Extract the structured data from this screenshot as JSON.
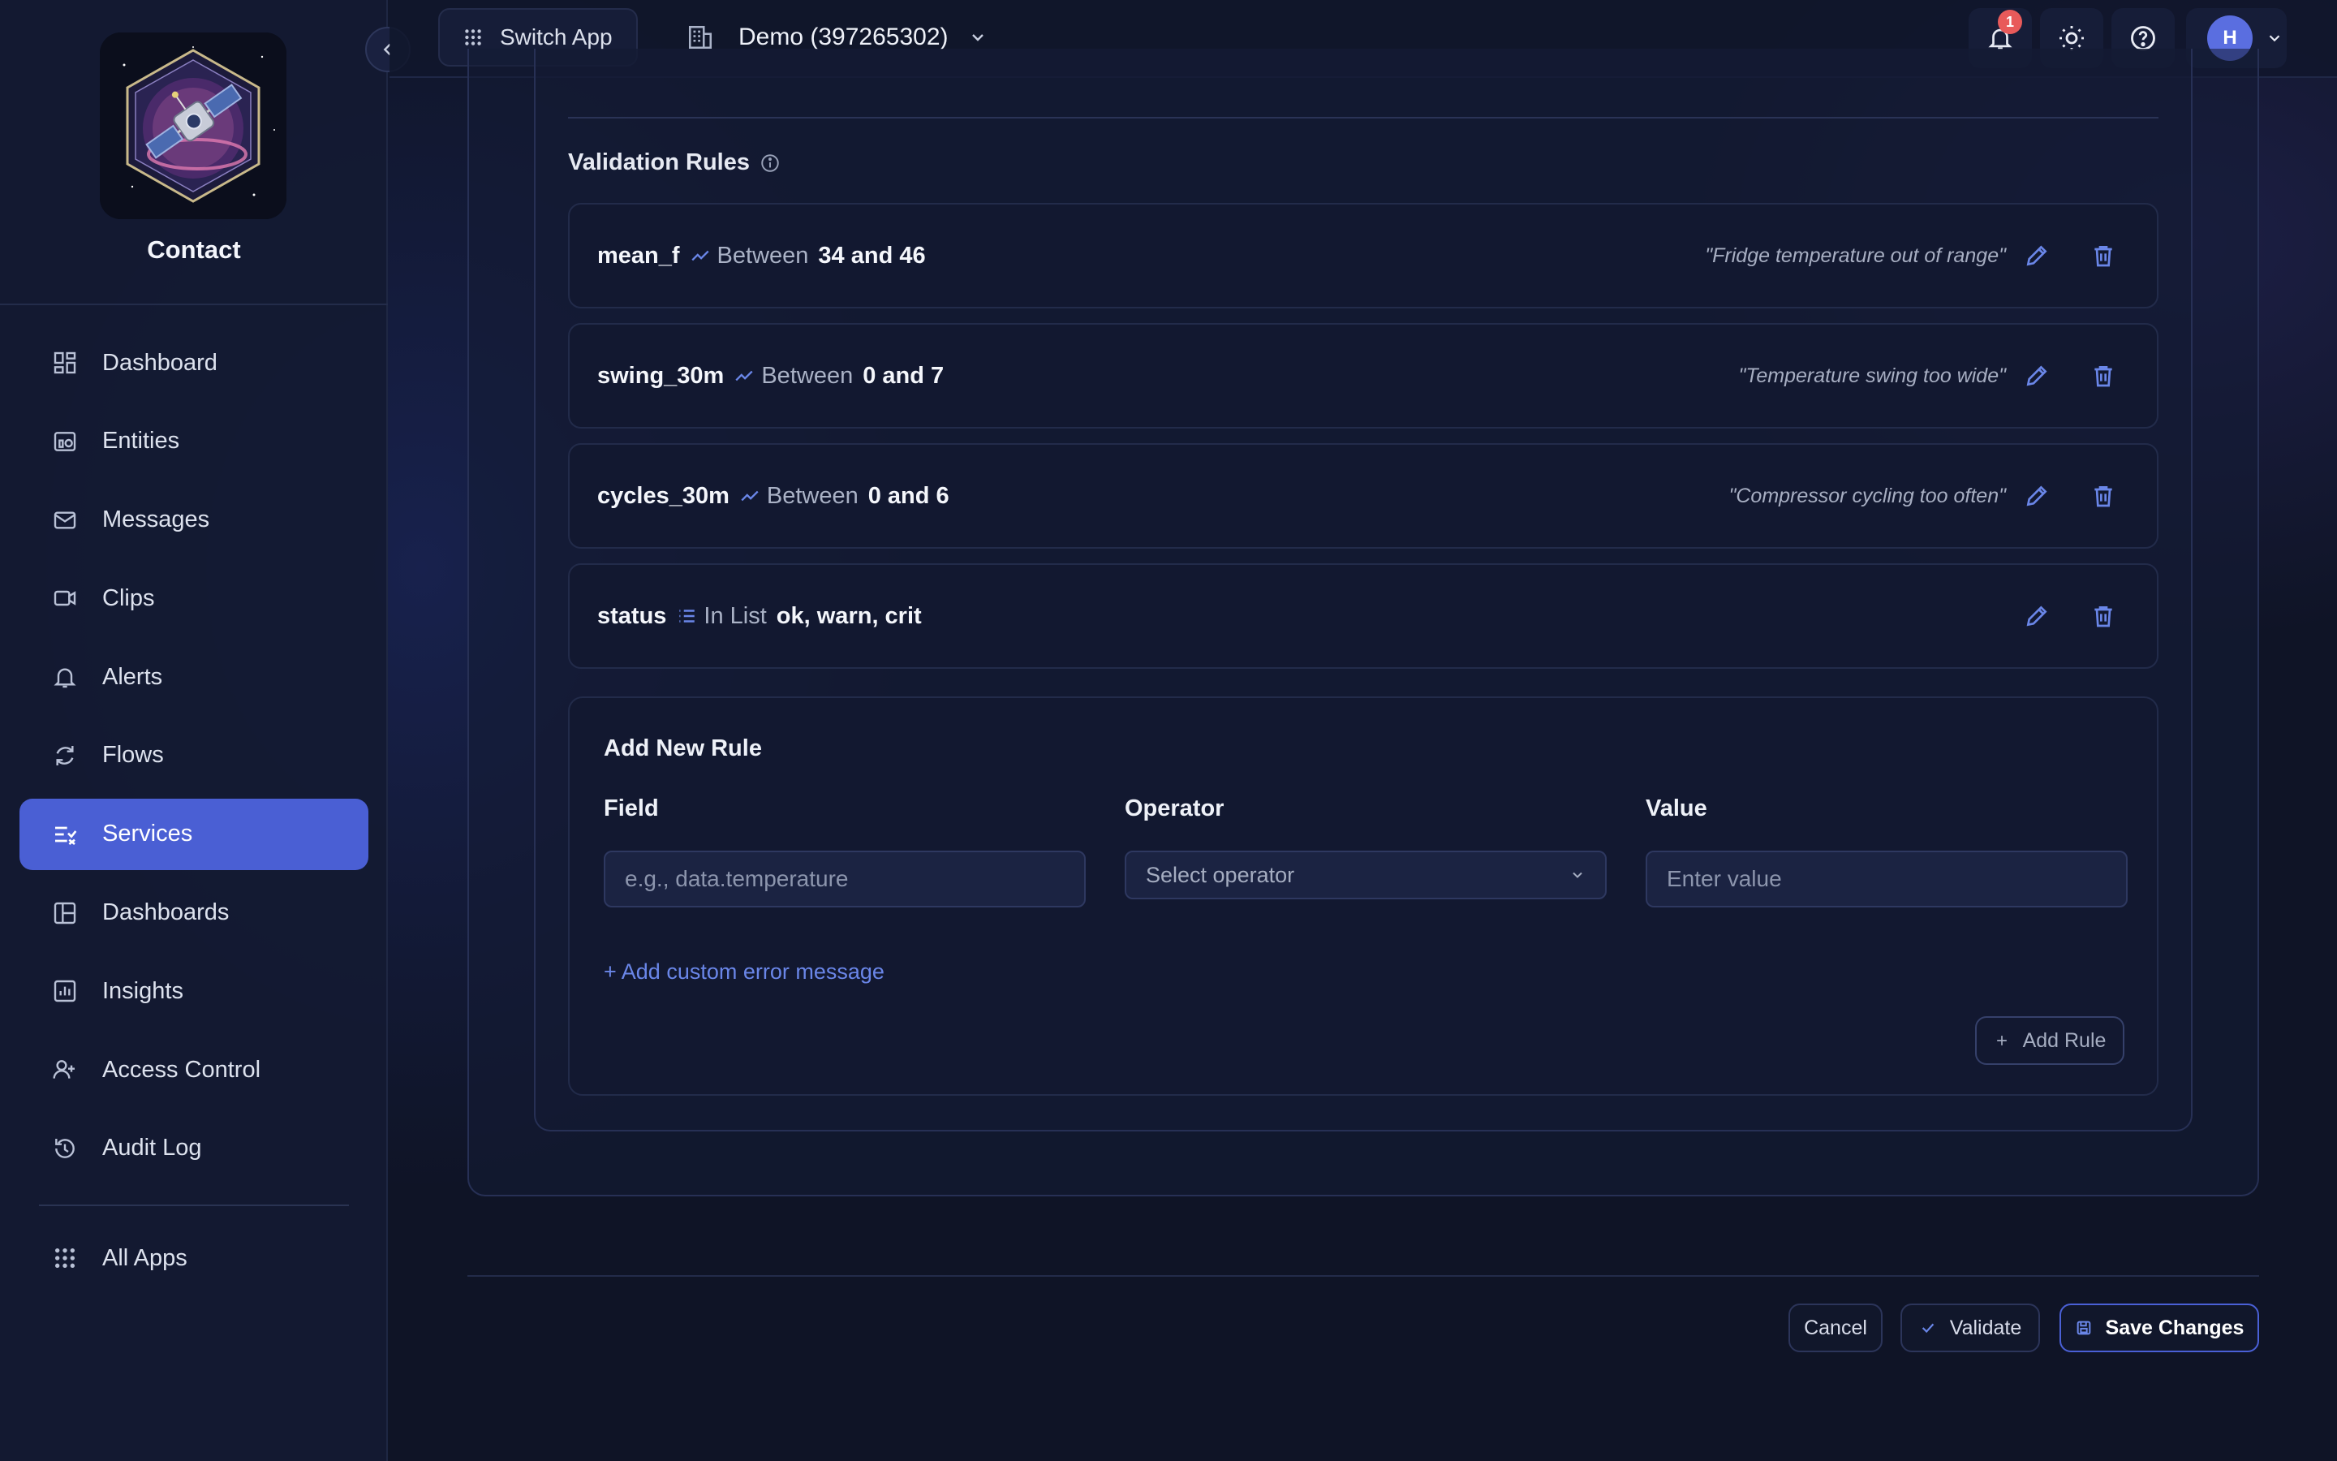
{
  "sidebar": {
    "app_title": "Contact",
    "items": [
      {
        "label": "Dashboard",
        "icon": "dashboard-icon"
      },
      {
        "label": "Entities",
        "icon": "entities-icon"
      },
      {
        "label": "Messages",
        "icon": "mail-icon"
      },
      {
        "label": "Clips",
        "icon": "video-icon"
      },
      {
        "label": "Alerts",
        "icon": "bell-icon"
      },
      {
        "label": "Flows",
        "icon": "refresh-icon"
      },
      {
        "label": "Services",
        "icon": "list-check-icon",
        "active": true
      },
      {
        "label": "Dashboards",
        "icon": "layout-icon"
      },
      {
        "label": "Insights",
        "icon": "chart-icon"
      },
      {
        "label": "Access Control",
        "icon": "users-icon"
      },
      {
        "label": "Audit Log",
        "icon": "history-icon"
      }
    ],
    "bottom_item": {
      "label": "All Apps",
      "icon": "grid-icon"
    }
  },
  "topbar": {
    "switch_app_label": "Switch App",
    "org_label": "Demo (397265302)",
    "notification_count": "1",
    "user_initial": "H"
  },
  "validation": {
    "title": "Validation Rules",
    "rules": [
      {
        "field": "mean_f",
        "operator": "Between",
        "value": "34 and 46",
        "message": "\"Fridge temperature out of range\"",
        "operator_icon": "trend-icon"
      },
      {
        "field": "swing_30m",
        "operator": "Between",
        "value": "0 and 7",
        "message": "\"Temperature swing too wide\"",
        "operator_icon": "trend-icon"
      },
      {
        "field": "cycles_30m",
        "operator": "Between",
        "value": "0 and 6",
        "message": "\"Compressor cycling too often\"",
        "operator_icon": "trend-icon"
      },
      {
        "field": "status",
        "operator": "In List",
        "value": "ok, warn, crit",
        "message": "",
        "operator_icon": "list-icon"
      }
    ]
  },
  "add_rule": {
    "title": "Add New Rule",
    "field_label": "Field",
    "field_placeholder": "e.g., data.temperature",
    "operator_label": "Operator",
    "operator_placeholder": "Select operator",
    "value_label": "Value",
    "value_placeholder": "Enter value",
    "custom_message_link": "+ Add custom error message",
    "add_button": "Add Rule"
  },
  "footer": {
    "cancel": "Cancel",
    "validate": "Validate",
    "save": "Save Changes"
  },
  "colors": {
    "accent": "#4a5fd4",
    "link": "#6a86e8",
    "badge": "#e85a5a"
  }
}
